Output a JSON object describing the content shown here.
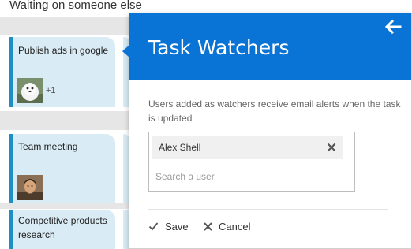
{
  "board": {
    "column_header": "Waiting on someone else",
    "cards": [
      {
        "title": "Publish ads in google",
        "extra_watchers": "+1"
      },
      {
        "title": "Team meeting"
      },
      {
        "title": "Competitive products research"
      }
    ]
  },
  "panel": {
    "title": "Task Watchers",
    "description": "Users added as watchers receive email alerts when the task is updated",
    "watchers": [
      {
        "name": "Alex Shell"
      }
    ],
    "search_placeholder": "Search a user",
    "save_label": "Save",
    "cancel_label": "Cancel",
    "icons": {
      "back": "arrow-left-icon",
      "remove": "close-icon",
      "save": "checkmark-icon",
      "cancel": "close-icon"
    }
  },
  "colors": {
    "header_blue": "#0a74d6",
    "card_background": "#d9ebf4",
    "card_accent": "#1e8fc4"
  }
}
